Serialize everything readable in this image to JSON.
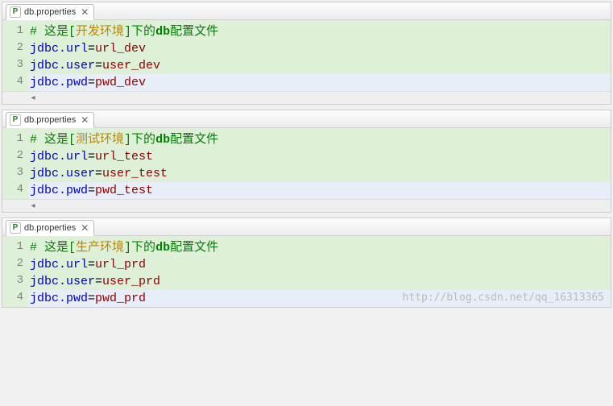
{
  "editors": [
    {
      "tab": {
        "icon_label": "P",
        "filename": "db.properties"
      },
      "lines": [
        {
          "n": 1,
          "type": "comment",
          "hash": "#",
          "pre": " 这是[",
          "env": "开发环境",
          "post": "]下的",
          "db": "db",
          "tail": "配置文件",
          "hl": false
        },
        {
          "n": 2,
          "type": "prop",
          "key": "jdbc.url",
          "eq": "=",
          "val": "url_dev",
          "hl": false
        },
        {
          "n": 3,
          "type": "prop",
          "key": "jdbc.user",
          "eq": "=",
          "val": "user_dev",
          "hl": false
        },
        {
          "n": 4,
          "type": "prop",
          "key": "jdbc.pwd",
          "eq": "=",
          "val": "pwd_dev",
          "hl": true
        }
      ]
    },
    {
      "tab": {
        "icon_label": "P",
        "filename": "db.properties"
      },
      "lines": [
        {
          "n": 1,
          "type": "comment",
          "hash": "#",
          "pre": " 这是[",
          "env": "测试环境",
          "post": "]下的",
          "db": "db",
          "tail": "配置文件",
          "hl": false
        },
        {
          "n": 2,
          "type": "prop",
          "key": "jdbc.url",
          "eq": "=",
          "val": "url_test",
          "hl": false
        },
        {
          "n": 3,
          "type": "prop",
          "key": "jdbc.user",
          "eq": "=",
          "val": "user_test",
          "hl": false
        },
        {
          "n": 4,
          "type": "prop",
          "key": "jdbc.pwd",
          "eq": "=",
          "val": "pwd_test",
          "hl": true
        }
      ]
    },
    {
      "tab": {
        "icon_label": "P",
        "filename": "db.properties"
      },
      "lines": [
        {
          "n": 1,
          "type": "comment",
          "hash": "#",
          "pre": " 这是[",
          "env": "生产环境",
          "post": "]下的",
          "db": "db",
          "tail": "配置文件",
          "hl": false
        },
        {
          "n": 2,
          "type": "prop",
          "key": "jdbc.url",
          "eq": "=",
          "val": "url_prd",
          "hl": false
        },
        {
          "n": 3,
          "type": "prop",
          "key": "jdbc.user",
          "eq": "=",
          "val": "user_prd",
          "hl": false
        },
        {
          "n": 4,
          "type": "prop",
          "key": "jdbc.pwd",
          "eq": "=",
          "val": "pwd_prd",
          "hl": true
        }
      ]
    }
  ],
  "watermark": "http://blog.csdn.net/qq_16313365",
  "close_glyph": "✕",
  "scroll_left_glyph": "◂"
}
